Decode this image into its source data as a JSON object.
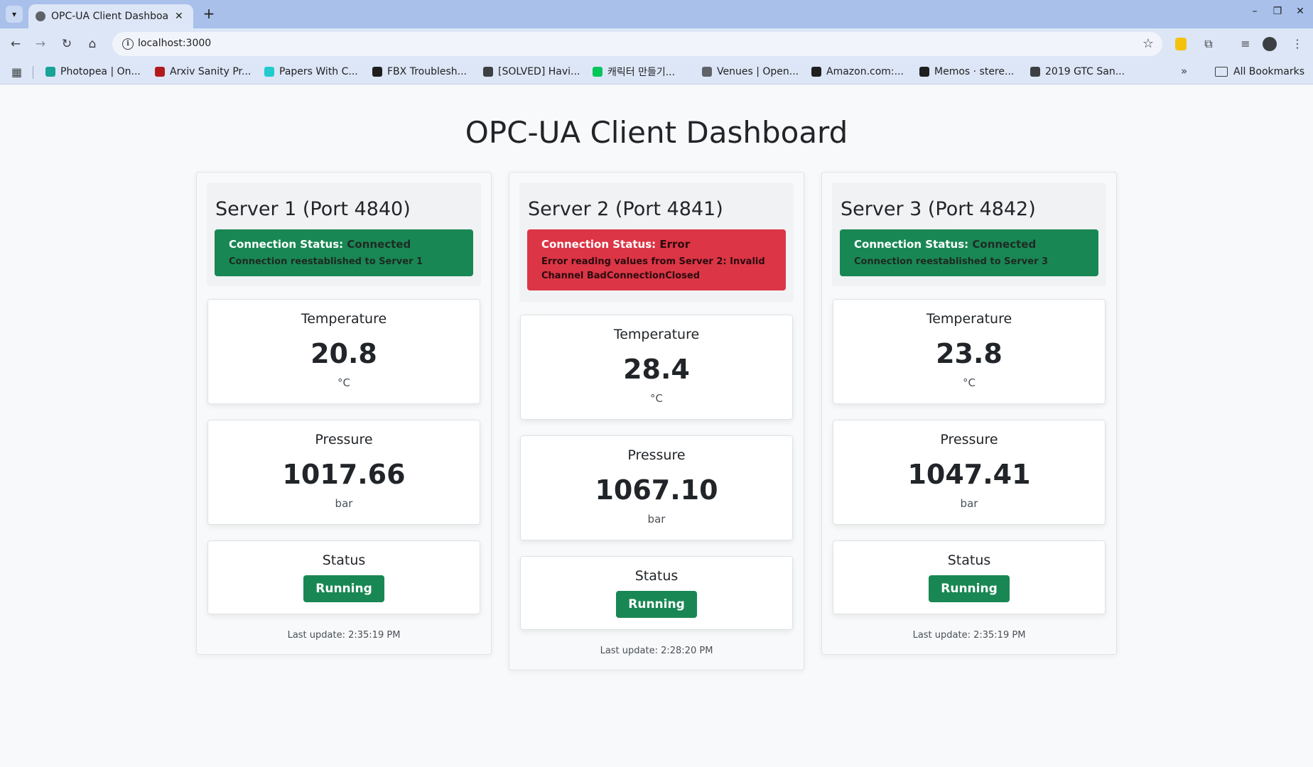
{
  "browser": {
    "tab_title": "OPC-UA Client Dashboard",
    "url": "localhost:3000",
    "bookmarks": [
      {
        "label": "Photopea | On...",
        "icon": "photopea-icon",
        "color": "#18a497"
      },
      {
        "label": "Arxiv Sanity Pr...",
        "icon": "arxiv-icon",
        "color": "#b31b1b"
      },
      {
        "label": "Papers With C...",
        "icon": "paperswithcode-icon",
        "color": "#21cbce"
      },
      {
        "label": "FBX Troublesh...",
        "icon": "autodesk-icon",
        "color": "#1f1f1f"
      },
      {
        "label": "[SOLVED] Havi...",
        "icon": "forum-icon",
        "color": "#3c4043"
      },
      {
        "label": "캐릭터 만들기...",
        "icon": "naver-icon",
        "color": "#03c75a"
      },
      {
        "label": "Venues | Open...",
        "icon": "document-icon",
        "color": "#5f6368"
      },
      {
        "label": "Amazon.com:...",
        "icon": "amazon-icon",
        "color": "#1f1f1f"
      },
      {
        "label": "Memos · stere...",
        "icon": "github-icon",
        "color": "#1f1f1f"
      },
      {
        "label": "2019 GTC San...",
        "icon": "globe-icon",
        "color": "#3c4043"
      }
    ],
    "all_bookmarks": "All Bookmarks"
  },
  "page": {
    "title": "OPC-UA Client Dashboard"
  },
  "labels": {
    "connection_status": "Connection Status:",
    "temperature": "Temperature",
    "pressure": "Pressure",
    "status": "Status",
    "temp_unit": "°C",
    "pressure_unit": "bar"
  },
  "servers": [
    {
      "title": "Server 1 (Port 4840)",
      "connection_state": "Connected",
      "connection_message": "Connection reestablished to Server 1",
      "temperature": "20.8",
      "pressure": "1017.66",
      "status": "Running",
      "last_update": "Last update: 2:35:19 PM"
    },
    {
      "title": "Server 2 (Port 4841)",
      "connection_state": "Error",
      "connection_message": "Error reading values from Server 2: Invalid Channel BadConnectionClosed",
      "temperature": "28.4",
      "pressure": "1067.10",
      "status": "Running",
      "last_update": "Last update: 2:28:20 PM"
    },
    {
      "title": "Server 3 (Port 4842)",
      "connection_state": "Connected",
      "connection_message": "Connection reestablished to Server 3",
      "temperature": "23.8",
      "pressure": "1047.41",
      "status": "Running",
      "last_update": "Last update: 2:35:19 PM"
    }
  ],
  "colors": {
    "success": "#198754",
    "danger": "#dc3545",
    "browser_frame": "#a8c0ea"
  }
}
